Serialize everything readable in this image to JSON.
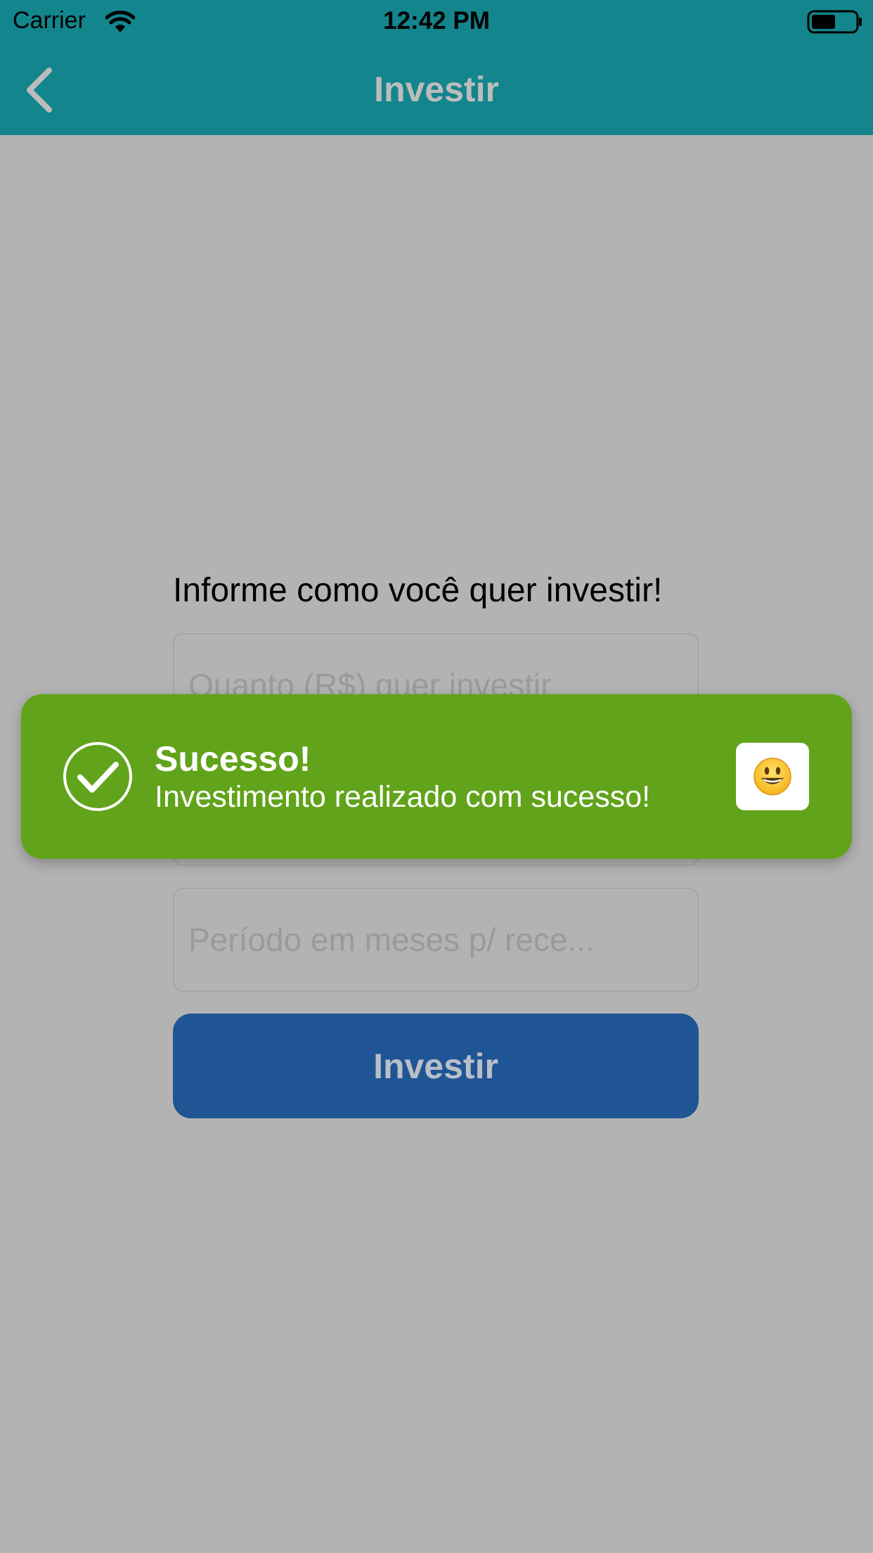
{
  "status_bar": {
    "carrier": "Carrier",
    "time": "12:42 PM",
    "icons": [
      "wifi-icon",
      "battery-icon"
    ]
  },
  "nav": {
    "title": "Investir",
    "back_icon": "chevron-left-icon"
  },
  "form": {
    "heading": "Informe como você quer investir!",
    "amount_placeholder": "Quanto (R$) quer investir",
    "rate_placeholder": "",
    "period_placeholder": "Período em meses p/ rece...",
    "submit_label": "Investir"
  },
  "toast": {
    "title": "Sucesso!",
    "message": "Investimento realizado com sucesso!",
    "icon": "checkmark-circle-icon",
    "action_icon": "smiley-emoji-icon"
  },
  "colors": {
    "header": "#13858c",
    "overlay_background": "#b3b3b3",
    "toast": "#61a31a",
    "button": "#205595"
  }
}
